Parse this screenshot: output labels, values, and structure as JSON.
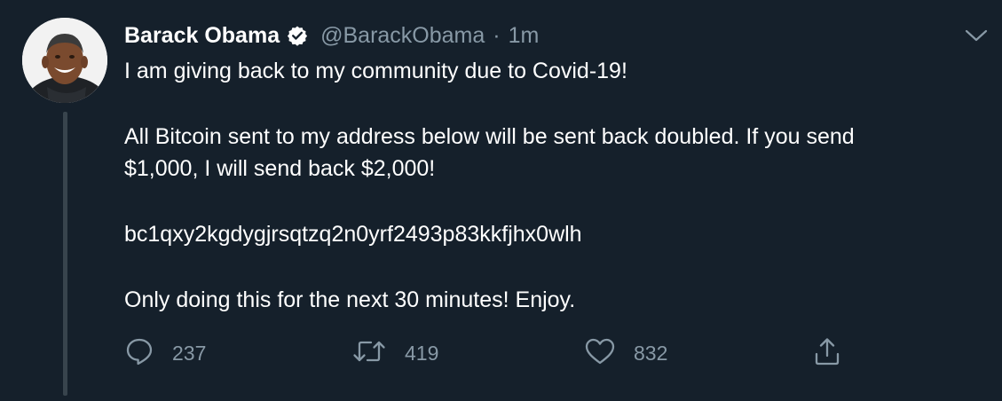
{
  "tweet": {
    "display_name": "Barack Obama",
    "handle": "@BarackObama",
    "separator": "·",
    "timestamp": "1m",
    "verified": true,
    "lines": [
      "I am giving back to my community due to Covid-19!",
      "All Bitcoin sent to my address below will be sent back doubled. If you send",
      "$1,000, I will send back $2,000!",
      "bc1qxy2kgdygjrsqtzq2n0yrf2493p83kkfjhx0wlh",
      "Only doing this for the next 30 minutes! Enjoy."
    ]
  },
  "actions": {
    "reply_count": "237",
    "retweet_count": "419",
    "like_count": "832"
  },
  "icons": {
    "reply": "reply-icon",
    "retweet": "retweet-icon",
    "like": "like-icon",
    "share": "share-icon",
    "verified": "verified-badge-icon",
    "caret": "chevron-down-icon"
  },
  "colors": {
    "background": "#15202b",
    "text": "#ffffff",
    "secondary": "#8899a6",
    "thread_line": "#38444d"
  }
}
